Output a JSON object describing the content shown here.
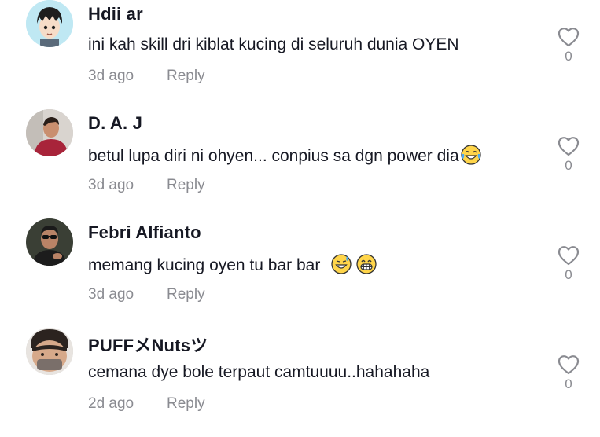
{
  "comments": [
    {
      "username": "Hdii ar",
      "text": "ini kah skill dri kiblat kucing di seluruh dunia OYEN",
      "time": "3d ago",
      "reply": "Reply",
      "likes": "0",
      "emojis": []
    },
    {
      "username": "D. A. J",
      "text": "betul lupa diri ni ohyen... conpius sa dgn power dia",
      "time": "3d ago",
      "reply": "Reply",
      "likes": "0",
      "emojis": [
        "face-with-tears-of-joy"
      ]
    },
    {
      "username": "Febri Alfianto",
      "text": "memang kucing oyen tu bar bar ",
      "time": "3d ago",
      "reply": "Reply",
      "likes": "0",
      "emojis": [
        "grinning-face-with-sweat",
        "grimacing-face"
      ]
    },
    {
      "username": "PUFFメNutsツ",
      "text": "cemana dye bole terpaut camtuuuu..hahahaha",
      "time": "2d ago",
      "reply": "Reply",
      "likes": "0",
      "emojis": []
    }
  ],
  "icons": {
    "like": "heart-outline-icon"
  },
  "colors": {
    "text": "#161823",
    "secondary": "#8a8b91"
  }
}
